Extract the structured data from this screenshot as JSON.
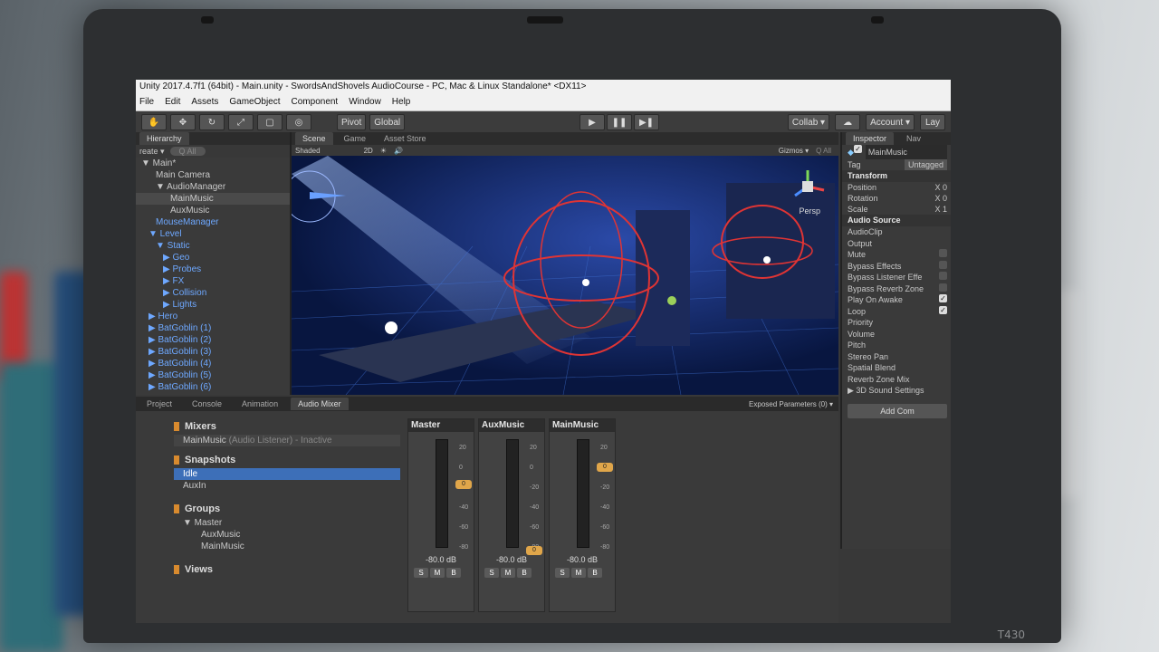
{
  "unity": {
    "title": "Unity 2017.4.7f1 (64bit) - Main.unity - SwordsAndShovels AudioCourse - PC, Mac & Linux Standalone* <DX11>",
    "menu": [
      "File",
      "Edit",
      "Assets",
      "GameObject",
      "Component",
      "Window",
      "Help"
    ],
    "toolbar": {
      "pivot": "Pivot",
      "global": "Global",
      "collab": "Collab ▾",
      "account": "Account ▾",
      "layers": "Lay"
    },
    "hierarchy": {
      "tab": "Hierarchy",
      "create": "reate ▾",
      "search_placeholder": "Q All",
      "rows": [
        {
          "text": "▼ Main*",
          "indent": 0,
          "blue": false,
          "sel": false
        },
        {
          "text": "Main Camera",
          "indent": 2,
          "blue": false,
          "sel": false
        },
        {
          "text": "▼ AudioManager",
          "indent": 2,
          "blue": false,
          "sel": false
        },
        {
          "text": "MainMusic",
          "indent": 4,
          "blue": false,
          "sel": true
        },
        {
          "text": "AuxMusic",
          "indent": 4,
          "blue": false,
          "sel": false
        },
        {
          "text": "MouseManager",
          "indent": 2,
          "blue": true,
          "sel": false
        },
        {
          "text": "▼ Level",
          "indent": 1,
          "blue": true,
          "sel": false
        },
        {
          "text": "▼ Static",
          "indent": 2,
          "blue": true,
          "sel": false
        },
        {
          "text": "▶ Geo",
          "indent": 3,
          "blue": true,
          "sel": false
        },
        {
          "text": "▶ Probes",
          "indent": 3,
          "blue": true,
          "sel": false
        },
        {
          "text": "▶ FX",
          "indent": 3,
          "blue": true,
          "sel": false
        },
        {
          "text": "▶ Collision",
          "indent": 3,
          "blue": true,
          "sel": false
        },
        {
          "text": "▶ Lights",
          "indent": 3,
          "blue": true,
          "sel": false
        },
        {
          "text": "▶ Hero",
          "indent": 1,
          "blue": true,
          "sel": false
        },
        {
          "text": "▶ BatGoblin (1)",
          "indent": 1,
          "blue": true,
          "sel": false
        },
        {
          "text": "▶ BatGoblin (2)",
          "indent": 1,
          "blue": true,
          "sel": false
        },
        {
          "text": "▶ BatGoblin (3)",
          "indent": 1,
          "blue": true,
          "sel": false
        },
        {
          "text": "▶ BatGoblin (4)",
          "indent": 1,
          "blue": true,
          "sel": false
        },
        {
          "text": "▶ BatGoblin (5)",
          "indent": 1,
          "blue": true,
          "sel": false
        },
        {
          "text": "▶ BatGoblin (6)",
          "indent": 1,
          "blue": true,
          "sel": false
        }
      ]
    },
    "scene": {
      "tabs": [
        "Scene",
        "Game",
        "Asset Store"
      ],
      "shading": "Shaded",
      "mode": "2D",
      "gizmos": "Gizmos ▾",
      "search_placeholder": "Q All",
      "persp": "Persp"
    },
    "inspector": {
      "tabs": [
        "Inspector",
        "Nav"
      ],
      "object": "MainMusic",
      "tag_label": "Tag",
      "tag": "Untagged",
      "transform": {
        "title": "Transform",
        "rows": [
          [
            "Position",
            "X 0"
          ],
          [
            "Rotation",
            "X 0"
          ],
          [
            "Scale",
            "X 1"
          ]
        ]
      },
      "audio_source": {
        "title": "Audio Source",
        "rows": [
          {
            "label": "AudioClip",
            "check": null
          },
          {
            "label": "Output",
            "check": null
          },
          {
            "label": "Mute",
            "check": false
          },
          {
            "label": "Bypass Effects",
            "check": false
          },
          {
            "label": "Bypass Listener Effe",
            "check": false
          },
          {
            "label": "Bypass Reverb Zone",
            "check": false
          },
          {
            "label": "Play On Awake",
            "check": true
          },
          {
            "label": "Loop",
            "check": true
          },
          {
            "label": "Priority",
            "check": null
          },
          {
            "label": "Volume",
            "check": null
          },
          {
            "label": "Pitch",
            "check": null
          },
          {
            "label": "Stereo Pan",
            "check": null
          },
          {
            "label": "Spatial Blend",
            "check": null
          },
          {
            "label": "Reverb Zone Mix",
            "check": null
          },
          {
            "label": "▶ 3D Sound Settings",
            "check": null
          }
        ]
      },
      "add_component": "Add Com"
    },
    "bottom": {
      "tabs": [
        "Project",
        "Console",
        "Animation",
        "Audio Mixer"
      ],
      "exposed": "Exposed Parameters (0) ▾",
      "mixers_title": "Mixers",
      "mixer": "MainMusic",
      "mixer_state": "(Audio Listener) - Inactive",
      "snapshots_title": "Snapshots",
      "snapshots": [
        "Idle",
        "AuxIn"
      ],
      "groups_title": "Groups",
      "groups": [
        "▼ Master",
        "AuxMusic",
        "MainMusic"
      ],
      "views_title": "Views",
      "strips": [
        {
          "name": "Master",
          "db": "-80.0 dB",
          "fader": 0.62
        },
        {
          "name": "AuxMusic",
          "db": "-80.0 dB",
          "fader": 0.0
        },
        {
          "name": "MainMusic",
          "db": "-80.0 dB",
          "fader": 0.78
        }
      ],
      "scale": [
        "20",
        "0",
        "-20",
        "-40",
        "-60",
        "-80"
      ],
      "buttons": [
        "S",
        "M",
        "B"
      ]
    }
  },
  "laptop_model": "T430"
}
